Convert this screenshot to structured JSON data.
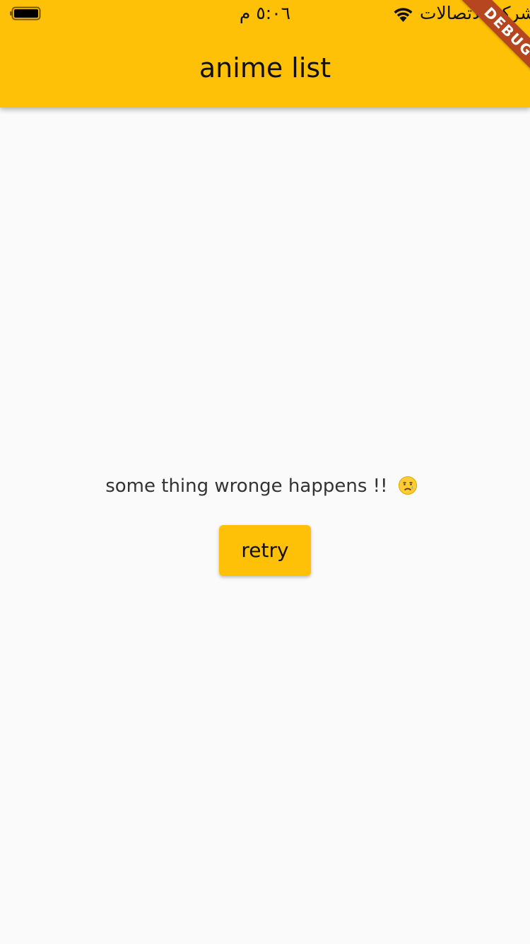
{
  "status_bar": {
    "time": "٥:٠٦ م",
    "carrier": "شركة الاتصالات",
    "wifi_icon": "wifi-icon",
    "battery_icon": "battery-icon"
  },
  "app_bar": {
    "title": "anime list",
    "background_color": "#ffc107"
  },
  "debug_banner": {
    "label": "DEBUG",
    "color": "#b5461f"
  },
  "error": {
    "message": "some thing wronge happens !!",
    "emoji_icon": "crying-face-icon"
  },
  "retry_button": {
    "label": "retry",
    "color": "#ffc107"
  }
}
